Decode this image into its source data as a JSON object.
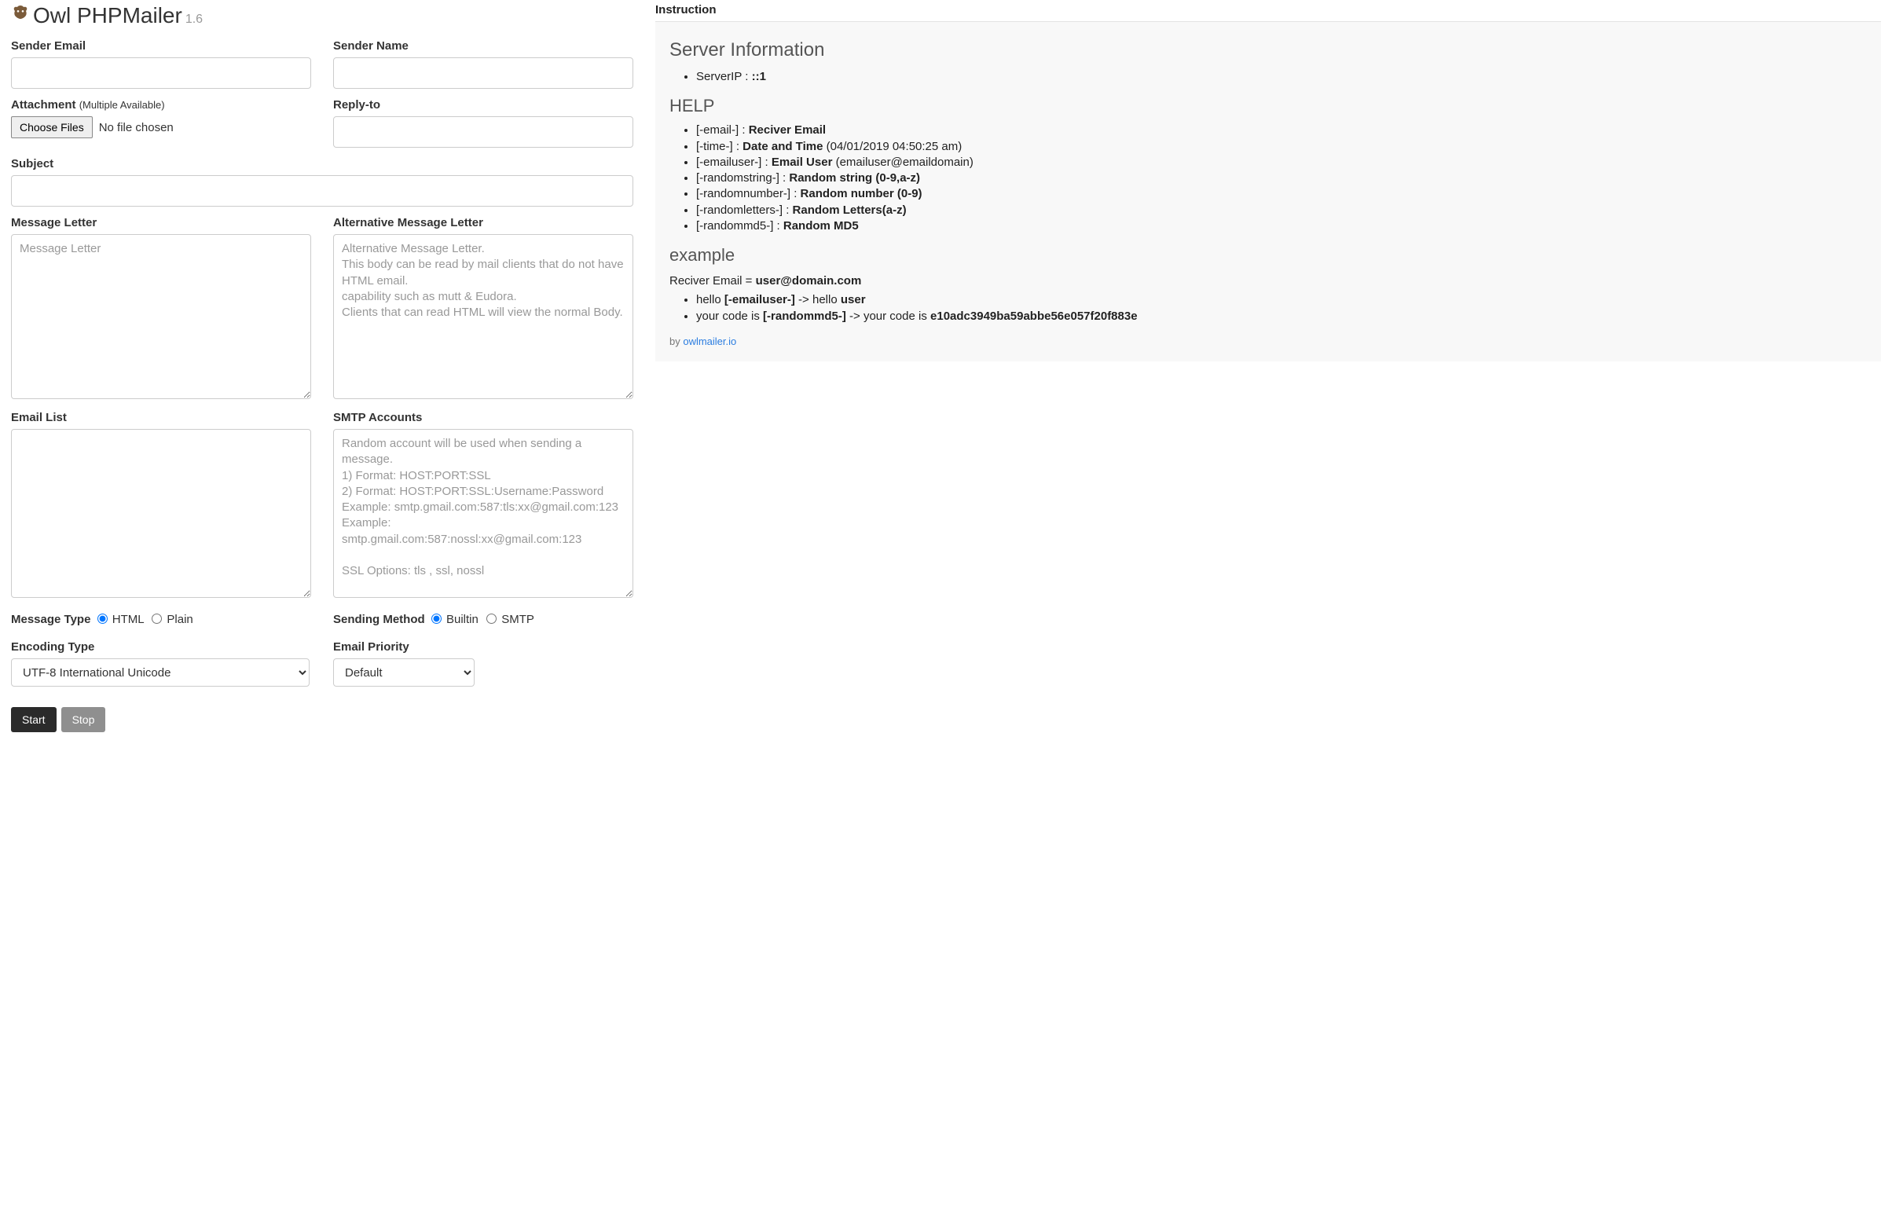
{
  "app": {
    "title": "Owl PHPMailer",
    "version": "1.6",
    "owl_icon": "owl-icon"
  },
  "labels": {
    "sender_email": "Sender Email",
    "sender_name": "Sender Name",
    "attachment": "Attachment ",
    "attachment_hint": "(Multiple Available)",
    "reply_to": "Reply-to",
    "subject": "Subject",
    "message_letter": "Message Letter",
    "alt_message_letter": "Alternative Message Letter",
    "email_list": "Email List",
    "smtp_accounts": "SMTP Accounts",
    "message_type": "Message Type",
    "html": "HTML",
    "plain": "Plain",
    "sending_method": "Sending Method",
    "builtin": "Builtin",
    "smtp": "SMTP",
    "encoding_type": "Encoding Type",
    "email_priority": "Email Priority",
    "choose_files": "Choose Files",
    "no_file": "No file chosen",
    "start": "Start",
    "stop": "Stop"
  },
  "placeholders": {
    "message_letter": "Message Letter",
    "alt_message_letter": "Alternative Message Letter.\nThis body can be read by mail clients that do not have HTML email.\ncapability such as mutt & Eudora.\nClients that can read HTML will view the normal Body.",
    "smtp_accounts": "Random account will be used when sending a message.\n1) Format: HOST:PORT:SSL\n2) Format: HOST:PORT:SSL:Username:Password\nExample: smtp.gmail.com:587:tls:xx@gmail.com:123\nExample: smtp.gmail.com:587:nossl:xx@gmail.com:123\n\nSSL Options: tls , ssl, nossl"
  },
  "selects": {
    "encoding": "UTF-8 International Unicode",
    "priority": "Default"
  },
  "instruction": {
    "heading": "Instruction",
    "server_info_h": "Server Information",
    "server_ip_label": "ServerIP : ",
    "server_ip_value": "::1",
    "help_h": "HELP",
    "help_items": [
      {
        "tag": "[-email-] : ",
        "bold": "Reciver Email",
        "tail": ""
      },
      {
        "tag": "[-time-] : ",
        "bold": "Date and Time",
        "tail": " (04/01/2019 04:50:25 am)"
      },
      {
        "tag": "[-emailuser-] : ",
        "bold": "Email User",
        "tail": " (emailuser@emaildomain)"
      },
      {
        "tag": "[-randomstring-] : ",
        "bold": "Random string (0-9,a-z)",
        "tail": ""
      },
      {
        "tag": "[-randomnumber-] : ",
        "bold": "Random number (0-9)",
        "tail": ""
      },
      {
        "tag": "[-randomletters-] : ",
        "bold": "Random Letters(a-z)",
        "tail": ""
      },
      {
        "tag": "[-randommd5-] : ",
        "bold": "Random MD5",
        "tail": ""
      }
    ],
    "example_h": "example",
    "example_intro_pre": "Reciver Email = ",
    "example_intro_bold": "user@domain.com",
    "example_items": [
      {
        "pre": "hello ",
        "bold1": "[-emailuser-]",
        "mid": " -> hello ",
        "bold2": "user"
      },
      {
        "pre": "your code is ",
        "bold1": "[-randommd5-]",
        "mid": " -> your code is ",
        "bold2": "e10adc3949ba59abbe56e057f20f883e"
      }
    ],
    "by_pre": "by ",
    "by_link": "owlmailer.io"
  }
}
